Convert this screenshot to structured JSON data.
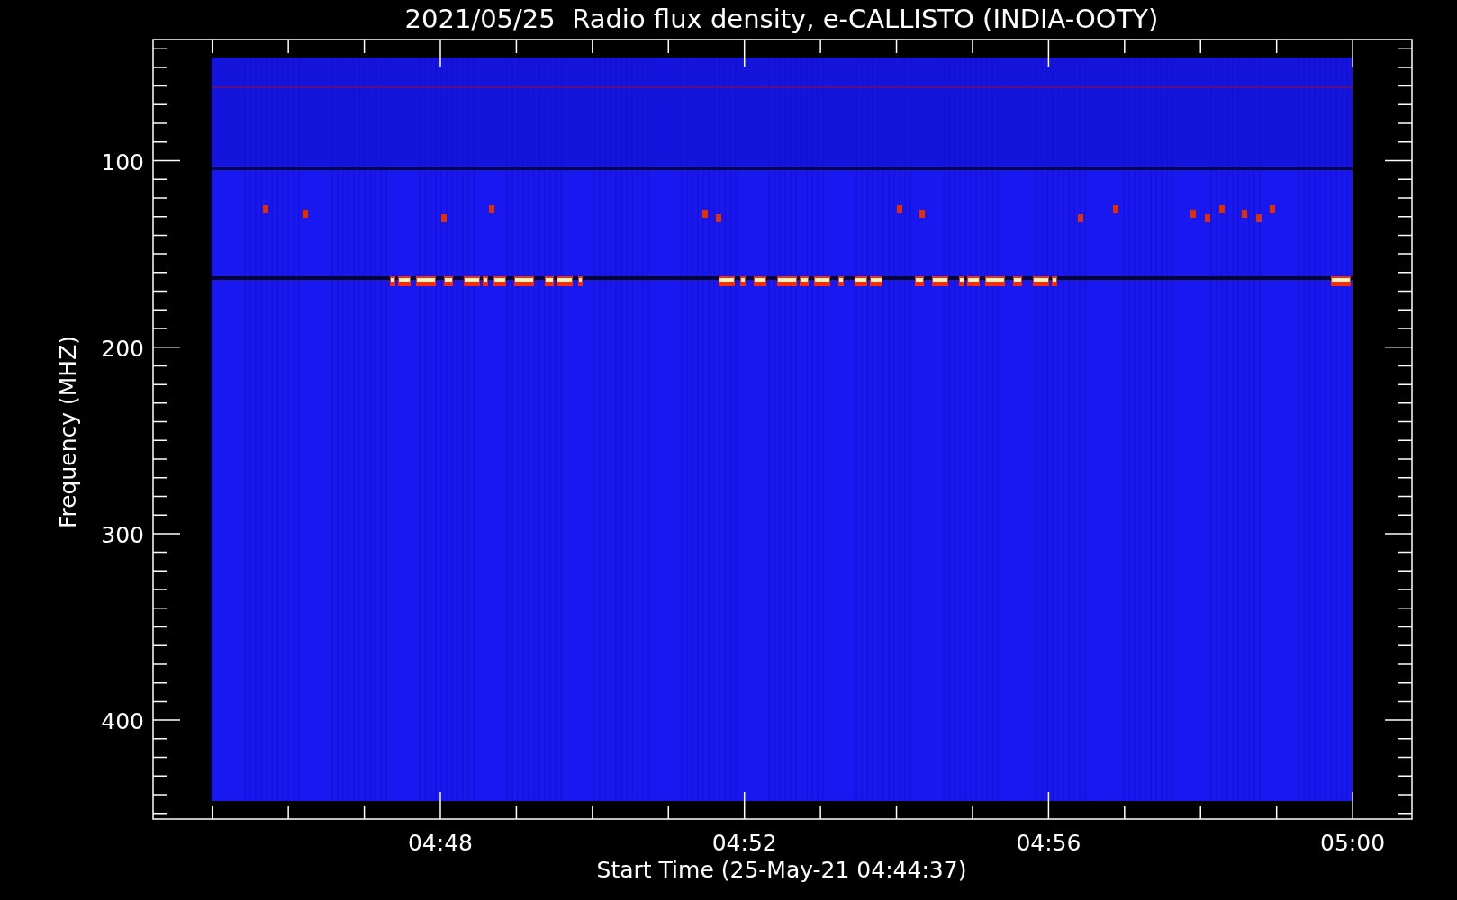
{
  "title": "2021/05/25  Radio flux density, e-CALLISTO (INDIA-OOTY)",
  "y_axis": {
    "label": "Frequency (MHZ)",
    "ticks": [
      "100",
      "200",
      "300",
      "400"
    ]
  },
  "x_axis": {
    "label": "Start Time (25-May-21 04:44:37)",
    "ticks": [
      "04:48",
      "04:52",
      "04:56",
      "05:00"
    ]
  }
}
